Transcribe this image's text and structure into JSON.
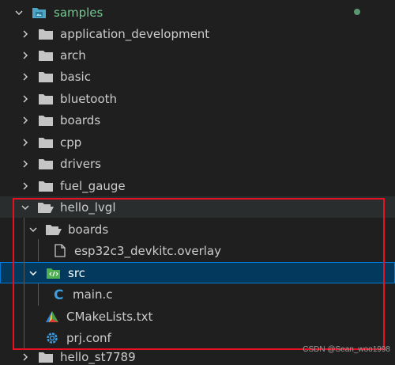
{
  "root": {
    "label": "samples",
    "icon": "folder-open-icon"
  },
  "items": [
    {
      "label": "application_development",
      "icon": "folder-icon",
      "expanded": false
    },
    {
      "label": "arch",
      "icon": "folder-icon",
      "expanded": false
    },
    {
      "label": "basic",
      "icon": "folder-icon",
      "expanded": false
    },
    {
      "label": "bluetooth",
      "icon": "folder-icon",
      "expanded": false
    },
    {
      "label": "boards",
      "icon": "folder-icon",
      "expanded": false
    },
    {
      "label": "cpp",
      "icon": "folder-icon",
      "expanded": false
    },
    {
      "label": "drivers",
      "icon": "folder-icon",
      "expanded": false
    },
    {
      "label": "fuel_gauge",
      "icon": "folder-icon",
      "expanded": false
    },
    {
      "label": "hello_lvgl",
      "icon": "folder-open-icon",
      "expanded": true
    },
    {
      "label": "boards",
      "icon": "folder-open-icon",
      "expanded": true
    },
    {
      "label": "esp32c3_devkitc.overlay",
      "icon": "file-icon"
    },
    {
      "label": "src",
      "icon": "source-folder-icon",
      "expanded": true
    },
    {
      "label": "main.c",
      "icon": "c-file-icon"
    },
    {
      "label": "CMakeLists.txt",
      "icon": "cmake-icon"
    },
    {
      "label": "prj.conf",
      "icon": "gear-icon"
    },
    {
      "label": "hello_st7789",
      "icon": "folder-icon",
      "expanded": false
    }
  ],
  "watermark": "CSDN @Sean_woo1998",
  "colors": {
    "background": "#1f1f1f",
    "selection": "#04395e",
    "selection_border": "#0078d4",
    "highlight_box": "#e81123",
    "root_text": "#73c991"
  }
}
